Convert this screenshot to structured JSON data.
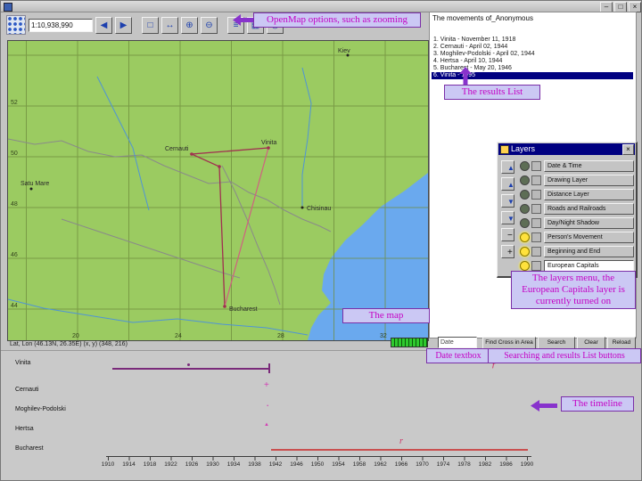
{
  "window": {
    "controls": {
      "minimize": "–",
      "maximize": "□",
      "close": "×"
    }
  },
  "toolbar": {
    "scale_value": "1:10,938,990",
    "buttons": [
      {
        "name": "back",
        "glyph": "◀"
      },
      {
        "name": "forward",
        "glyph": "▶"
      },
      {
        "name": "select",
        "glyph": "□"
      },
      {
        "name": "pan",
        "glyph": "↔"
      },
      {
        "name": "zoom-in",
        "glyph": "⊕"
      },
      {
        "name": "zoom-out",
        "glyph": "⊖"
      },
      {
        "name": "layers",
        "glyph": "≡"
      },
      {
        "name": "grid",
        "glyph": "▦"
      },
      {
        "name": "projection",
        "glyph": "◎"
      }
    ]
  },
  "results": {
    "title": "The movements of_Anonymous",
    "items": [
      "1. Vinita - November 11, 1918",
      "2. Cernauti - April 02, 1944",
      "3. Moghilev-Podolski - April 02, 1944",
      "4. Hertsa - April 10, 1944",
      "5. Bucharest - May 20, 1946",
      "6. Vinita - 1995"
    ],
    "selected_index": 5
  },
  "map": {
    "cities": [
      {
        "name": "Kiev"
      },
      {
        "name": "Satu Mare"
      },
      {
        "name": "Vinita"
      },
      {
        "name": "Cernauti"
      },
      {
        "name": "Chisinau"
      },
      {
        "name": "Bucharest"
      }
    ],
    "lat_labels": [
      "52",
      "50",
      "48",
      "46",
      "44"
    ],
    "lon_labels": [
      "20",
      "24",
      "28",
      "32"
    ],
    "colors": {
      "land": "#9bcb61",
      "water": "#6aa9ee",
      "route": "#a03050",
      "begin_end": "#d06080"
    }
  },
  "statusbar": {
    "coords": "Lat, Lon (46.13N, 26.35E)    (x, y) (348, 216)"
  },
  "controls": {
    "date_value": "Date",
    "buttons": [
      "Find Cross in Area",
      "Search",
      "Clear",
      "Reload"
    ]
  },
  "layers_window": {
    "title": "Layers",
    "close_glyph": "×",
    "order_buttons": [
      "▲",
      "▲",
      "▼",
      "▼",
      "−",
      "+"
    ],
    "layers": [
      {
        "label": "Date & Time",
        "on": false
      },
      {
        "label": "Drawing Layer",
        "on": false
      },
      {
        "label": "Distance Layer",
        "on": false
      },
      {
        "label": "Roads and Railroads",
        "on": false
      },
      {
        "label": "Day/Night Shadow",
        "on": false
      },
      {
        "label": "Person's Movement",
        "on": true
      },
      {
        "label": "Beginning and End",
        "on": true
      },
      {
        "label": "European Capitals",
        "on": true,
        "selected": true
      }
    ]
  },
  "timeline": {
    "rows": [
      {
        "label": "Vinita",
        "bar_years": [
          1918,
          1944
        ]
      },
      {
        "label": "Cernauti",
        "marker_year": 1944,
        "marker_glyph": "+"
      },
      {
        "label": "Moghilev-Podolski",
        "marker_year": 1944,
        "marker_glyph": "·"
      },
      {
        "label": "Hertsa",
        "marker_year": 1944,
        "marker_glyph": "▲"
      },
      {
        "label": "Bucharest",
        "bar_years": [
          1944,
          1990
        ],
        "marker_year": 1966,
        "marker_glyph": "r"
      }
    ],
    "axis_years": [
      1910,
      1914,
      1918,
      1922,
      1926,
      1930,
      1934,
      1938,
      1942,
      1946,
      1950,
      1954,
      1958,
      1962,
      1966,
      1970,
      1974,
      1978,
      1982,
      1986,
      1990
    ]
  },
  "annotations": {
    "openmap_options": "OpenMap options, such as zooming",
    "results_list": "The results List",
    "map": "The map",
    "layers_menu": "The layers menu, the European Capitals layer is currently turned on",
    "date_textbox": "Date textbox",
    "search_buttons": "Searching and results List buttons",
    "timeline": "The timeline"
  },
  "marks": {
    "search_mark": "ƒ"
  }
}
